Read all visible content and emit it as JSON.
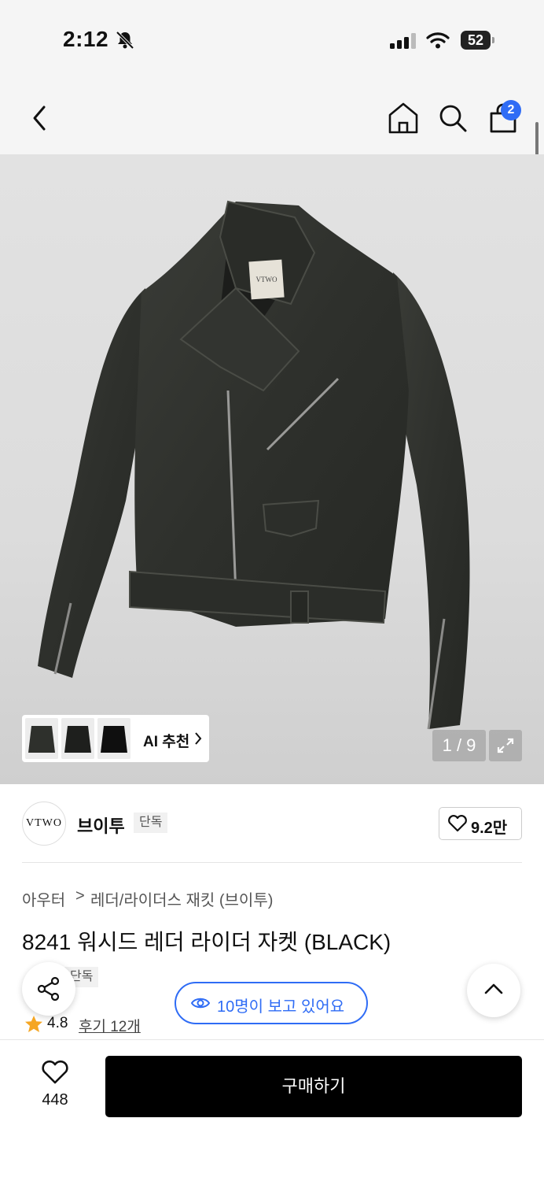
{
  "status_bar": {
    "time": "2:12",
    "battery": "52"
  },
  "header": {
    "cart_count": "2"
  },
  "gallery": {
    "ai_label": "AI 추천",
    "counter": "1 / 9",
    "jacket_label": "VTWO"
  },
  "brand": {
    "logo_text": "VTWO",
    "name": "브이투",
    "tag": "단독",
    "likes": "9.2만"
  },
  "breadcrumb": {
    "level1": "아우터",
    "separator": ">",
    "level2": "레더/라이더스 재킷 (브이투)"
  },
  "product": {
    "title": "8241 워시드 레더 라이더 자켓 (BLACK)",
    "tag": "단독",
    "rating": "4.8",
    "reviews": "후기 12개"
  },
  "viewers": {
    "text": "10명이 보고 있어요"
  },
  "bottom": {
    "wish_count": "448",
    "buy_label": "구매하기"
  },
  "colors": {
    "accent": "#2f6cf5",
    "buy_bg": "#000000",
    "star": "#f5a623"
  }
}
